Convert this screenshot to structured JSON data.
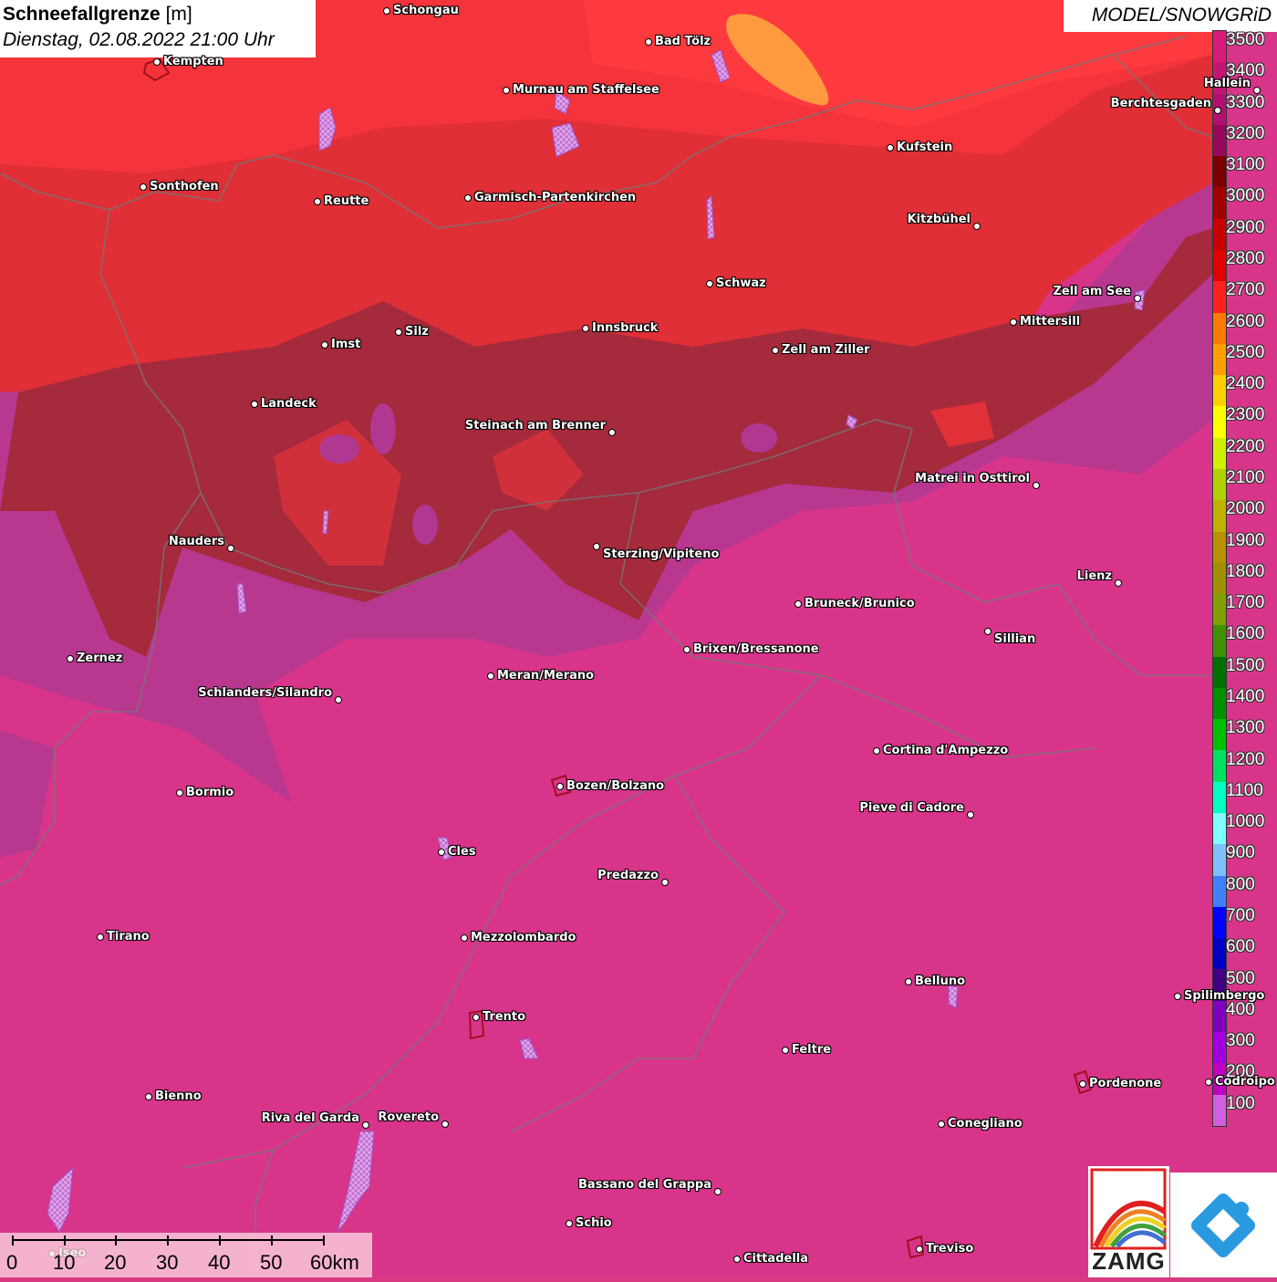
{
  "header": {
    "title_bold": "Schneefallgrenze",
    "title_unit": "[m]",
    "datetime": "Dienstag, 02.08.2022 21:00 Uhr"
  },
  "model_label": "MODEL/SNOWGRiD",
  "legend": {
    "unit": "m",
    "labels": [
      "3500",
      "3400",
      "3300",
      "3200",
      "3100",
      "3000",
      "2900",
      "2800",
      "2700",
      "2600",
      "2500",
      "2400",
      "2300",
      "2200",
      "2100",
      "2000",
      "1900",
      "1800",
      "1700",
      "1600",
      "1500",
      "1400",
      "1300",
      "1200",
      "1100",
      "1000",
      "900",
      "800",
      "700",
      "600",
      "500",
      "400",
      "300",
      "200",
      "100"
    ],
    "colors": [
      "#d81b7a",
      "#c41576",
      "#b01070",
      "#96095e",
      "#7a0000",
      "#a00000",
      "#c80000",
      "#e00000",
      "#ff2020",
      "#ff7a00",
      "#ffa000",
      "#ffd000",
      "#ffff00",
      "#d0f000",
      "#b0d000",
      "#c0b000",
      "#b89000",
      "#a09000",
      "#80a000",
      "#409000",
      "#007000",
      "#009000",
      "#00c000",
      "#00e060",
      "#00ffc0",
      "#80ffff",
      "#80c0ff",
      "#4080ff",
      "#0000ff",
      "#0000c0",
      "#400080",
      "#8000c0",
      "#a000e0",
      "#c000c0",
      "#d060e0"
    ]
  },
  "cities": [
    {
      "name": "Schongau"
    },
    {
      "name": "Bad Tölz"
    },
    {
      "name": "Kempten"
    },
    {
      "name": "Murnau am Staffelsee"
    },
    {
      "name": "Hallein"
    },
    {
      "name": "Berchtesgaden"
    },
    {
      "name": "Kufstein"
    },
    {
      "name": "Sonthofen"
    },
    {
      "name": "Reutte"
    },
    {
      "name": "Garmisch-Partenkirchen"
    },
    {
      "name": "Kitzbühel"
    },
    {
      "name": "Schwaz"
    },
    {
      "name": "Zell am See"
    },
    {
      "name": "Mittersill"
    },
    {
      "name": "Innsbruck"
    },
    {
      "name": "Imst"
    },
    {
      "name": "Silz"
    },
    {
      "name": "Zell am Ziller"
    },
    {
      "name": "Landeck"
    },
    {
      "name": "Steinach am Brenner"
    },
    {
      "name": "Matrei in Osttirol"
    },
    {
      "name": "Nauders"
    },
    {
      "name": "Sterzing/Vipiteno"
    },
    {
      "name": "Lienz"
    },
    {
      "name": "Bruneck/Brunico"
    },
    {
      "name": "Sillian"
    },
    {
      "name": "Zernez"
    },
    {
      "name": "Brixen/Bressanone"
    },
    {
      "name": "Meran/Merano"
    },
    {
      "name": "Schlanders/Silandro"
    },
    {
      "name": "Cortina d'Ampezzo"
    },
    {
      "name": "Bozen/Bolzano"
    },
    {
      "name": "Bormio"
    },
    {
      "name": "Pieve di Cadore"
    },
    {
      "name": "Cles"
    },
    {
      "name": "Predazzo"
    },
    {
      "name": "Tirano"
    },
    {
      "name": "Mezzolombardo"
    },
    {
      "name": "Belluno"
    },
    {
      "name": "Spilimbergo"
    },
    {
      "name": "Trento"
    },
    {
      "name": "Feltre"
    },
    {
      "name": "Pordenone"
    },
    {
      "name": "Codroipo"
    },
    {
      "name": "Bienno"
    },
    {
      "name": "Riva del Garda"
    },
    {
      "name": "Rovereto"
    },
    {
      "name": "Conegliano"
    },
    {
      "name": "Bassano del Grappa"
    },
    {
      "name": "Schio"
    },
    {
      "name": "Treviso"
    },
    {
      "name": "Iseo"
    },
    {
      "name": "Cittadella"
    }
  ],
  "scale_bar": {
    "labels": [
      "0",
      "10",
      "20",
      "30",
      "40",
      "50",
      "60km"
    ]
  },
  "logos": {
    "zamg": "ZAMG"
  }
}
